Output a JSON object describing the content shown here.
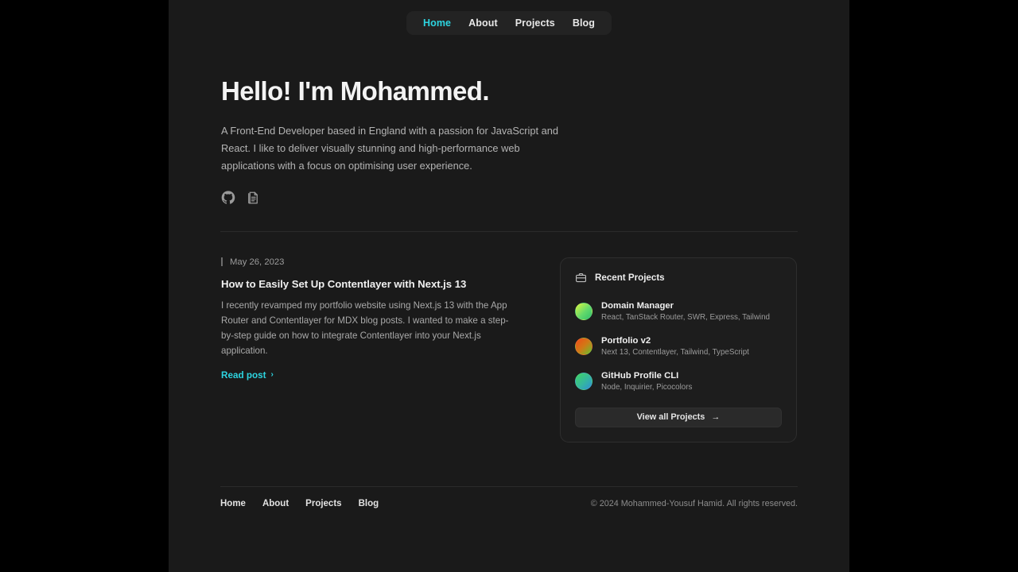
{
  "nav": {
    "items": [
      {
        "label": "Home",
        "active": true
      },
      {
        "label": "About",
        "active": false
      },
      {
        "label": "Projects",
        "active": false
      },
      {
        "label": "Blog",
        "active": false
      }
    ]
  },
  "hero": {
    "heading": "Hello! I'm Mohammed.",
    "intro": "A Front-End Developer based in England with a passion for JavaScript and React. I like to deliver visually stunning and high-performance web applications with a focus on optimising user experience.",
    "socials": [
      {
        "icon": "github-icon"
      },
      {
        "icon": "resume-document-icon"
      }
    ]
  },
  "post": {
    "date": "May 26, 2023",
    "title": "How to Easily Set Up Contentlayer with Next.js 13",
    "excerpt": "I recently revamped my portfolio website using Next.js 13 with the App Router and Contentlayer for MDX blog posts. I wanted to make a step-by-step guide on how to integrate Contentlayer into your Next.js application.",
    "read_more": "Read post",
    "read_more_chevron": "›"
  },
  "projects_card": {
    "icon": "briefcase-icon",
    "title": "Recent Projects",
    "items": [
      {
        "name": "Domain Manager",
        "stack": "React, TanStack Router, SWR, Express, Tailwind"
      },
      {
        "name": "Portfolio v2",
        "stack": "Next 13, Contentlayer, Tailwind, TypeScript"
      },
      {
        "name": "GitHub Profile CLI",
        "stack": "Node, Inquirier, Picocolors"
      }
    ],
    "view_all_label": "View all Projects",
    "view_all_arrow": "→"
  },
  "footer": {
    "nav": [
      {
        "label": "Home"
      },
      {
        "label": "About"
      },
      {
        "label": "Projects"
      },
      {
        "label": "Blog"
      }
    ],
    "copyright": "© 2024 Mohammed-Yousuf Hamid. All rights reserved."
  },
  "colors": {
    "page_background": "#1a1a1a",
    "letterbox": "#000000",
    "accent": "#2dd4e0",
    "card_background": "#1d1d1d",
    "card_border": "#2e2e2e",
    "heading": "#f3f3f3",
    "body_text": "#b4b4b4",
    "muted_text": "#9c9c9c"
  }
}
